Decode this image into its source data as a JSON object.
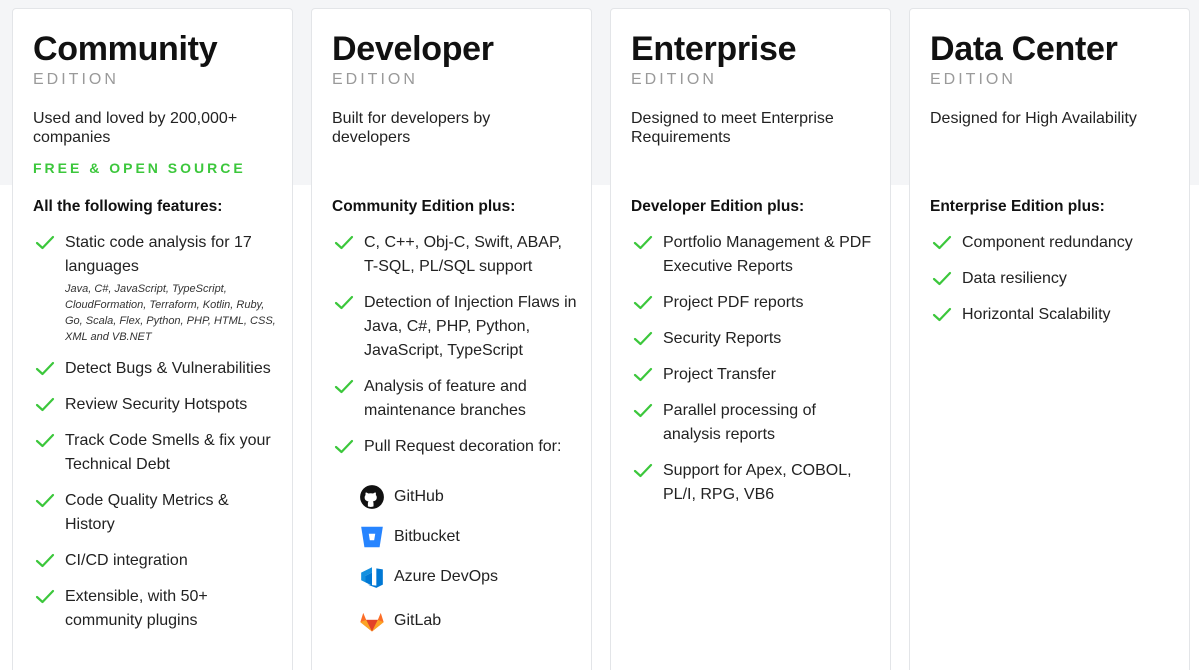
{
  "colors": {
    "check": "#3cc73c",
    "free_badge": "#3cc73c",
    "edition": "#9a9a9a",
    "band": "#f4f5f7"
  },
  "cards": [
    {
      "title": "Community",
      "edition": "EDITION",
      "tagline": "Used and loved by 200,000+ companies",
      "badge": "FREE & OPEN SOURCE",
      "section": "All the following features:",
      "features": [
        "Static code analysis for 17 languages",
        "Detect Bugs & Vulnerabilities",
        "Review Security Hotspots",
        "Track Code Smells & fix your Technical Debt",
        "Code Quality Metrics & History",
        "CI/CD integration",
        "Extensible, with 50+ community plugins"
      ],
      "languages_note": "Java, C#, JavaScript, TypeScript, CloudFormation, Terraform, Kotlin, Ruby, Go, Scala, Flex, Python, PHP, HTML, CSS, XML and VB.NET"
    },
    {
      "title": "Developer",
      "edition": "EDITION",
      "tagline": "Built for developers by developers",
      "section": "Community Edition plus:",
      "features": [
        "C, C++, Obj-C, Swift, ABAP, T-SQL, PL/SQL support",
        "Detection of Injection Flaws in Java, C#, PHP, Python, JavaScript, TypeScript",
        "Analysis of feature and maintenance branches",
        "Pull Request decoration for:"
      ],
      "integrations": [
        "GitHub",
        "Bitbucket",
        "Azure DevOps",
        "GitLab"
      ]
    },
    {
      "title": "Enterprise",
      "edition": "EDITION",
      "tagline": "Designed to meet Enterprise Requirements",
      "section": "Developer Edition plus:",
      "features": [
        "Portfolio Management & PDF Executive Reports",
        "Project PDF reports",
        "Security Reports",
        "Project Transfer",
        "Parallel processing of analysis reports",
        "Support for Apex, COBOL, PL/I, RPG, VB6"
      ]
    },
    {
      "title": "Data Center",
      "edition": "EDITION",
      "tagline": "Designed for High Availability",
      "section": "Enterprise Edition plus:",
      "features": [
        "Component redundancy",
        "Data resiliency",
        "Horizontal Scalability"
      ]
    }
  ],
  "icons": {
    "check": "check-icon",
    "github": "github-icon",
    "bitbucket": "bitbucket-icon",
    "azure": "azure-devops-icon",
    "gitlab": "gitlab-icon"
  }
}
